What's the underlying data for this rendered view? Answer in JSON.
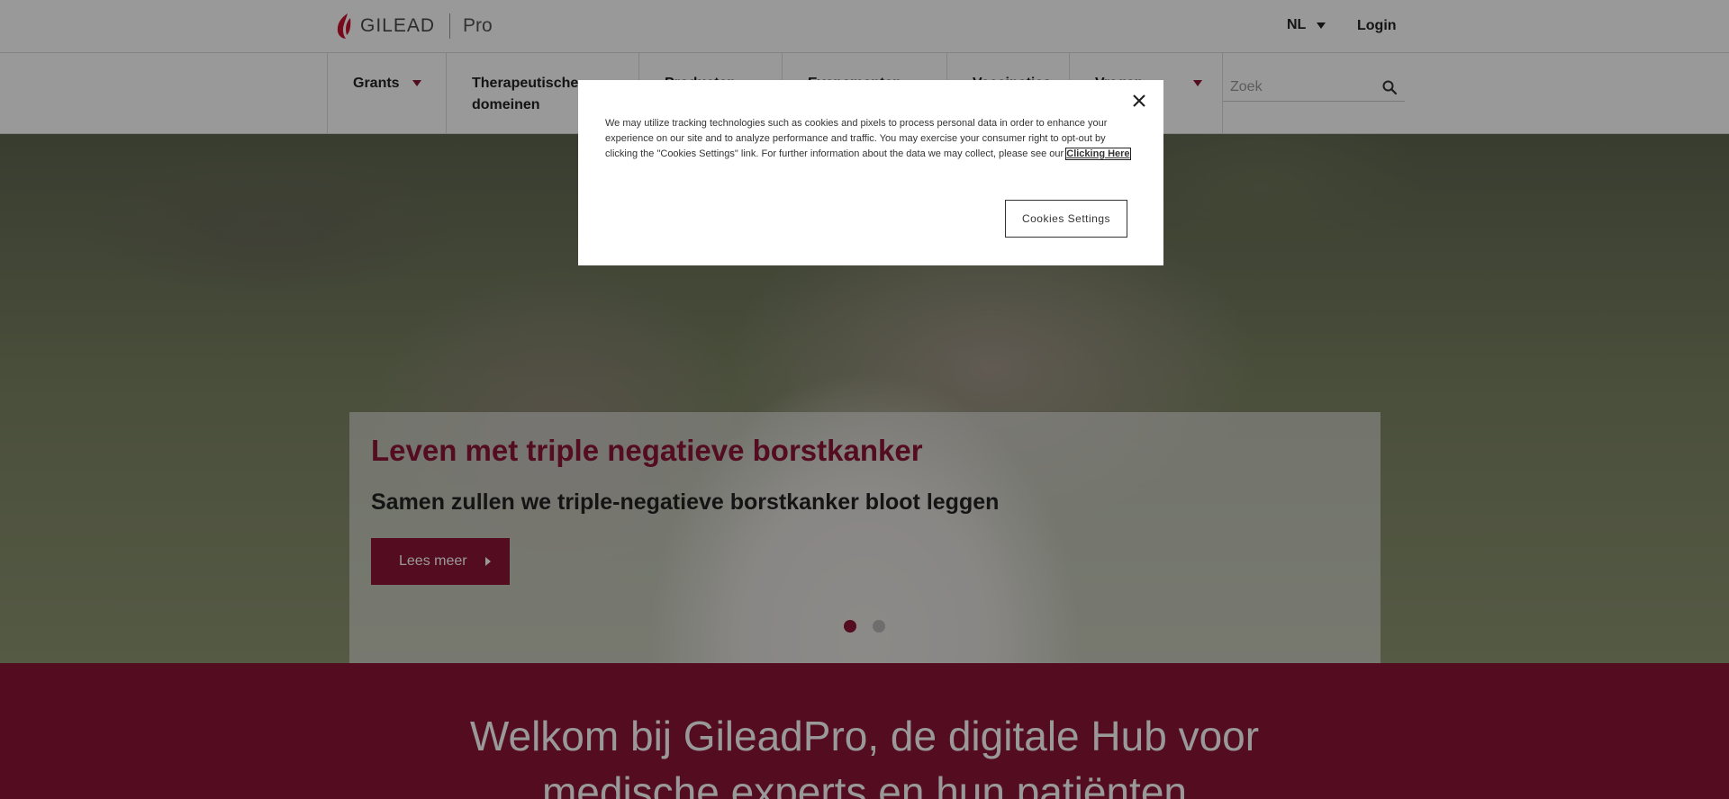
{
  "header": {
    "brand": "GILEAD",
    "sub_brand": "Pro",
    "language": "NL",
    "login_label": "Login"
  },
  "nav": {
    "items": [
      {
        "label": "Grants",
        "has_dropdown": true
      },
      {
        "label": "Therapeutische domeinen",
        "has_dropdown": true
      },
      {
        "label": "Producten",
        "has_dropdown": true
      },
      {
        "label": "Evenementen",
        "has_dropdown": true
      },
      {
        "label": "Vaccinaties",
        "has_dropdown": false
      },
      {
        "label": "Vragen",
        "has_dropdown": true
      }
    ],
    "search_placeholder": "Zoek"
  },
  "hero": {
    "title": "Leven met triple negatieve borstkanker",
    "subtitle": "Samen zullen we triple-negatieve borstkanker bloot leggen",
    "button_label": "Lees meer",
    "slides_count": 2,
    "active_slide": 1
  },
  "welcome": {
    "line1": "Welkom bij GileadPro, de digitale Hub voor",
    "line2": "medische experts en hun patiënten"
  },
  "cookie_dialog": {
    "text": "We may utilize tracking technologies such as cookies and pixels to process personal data in order to enhance your experience on our site and to analyze performance and traffic. You may exercise your consumer right to opt-out by clicking the \"Cookies Settings\" link. For further information about the data we may collect, please see our",
    "link_label": "Clicking Here",
    "settings_button_label": "Cookies Settings"
  },
  "colors": {
    "brand": "#8c1437",
    "overlay": "rgba(0,0,0,0.4)"
  }
}
